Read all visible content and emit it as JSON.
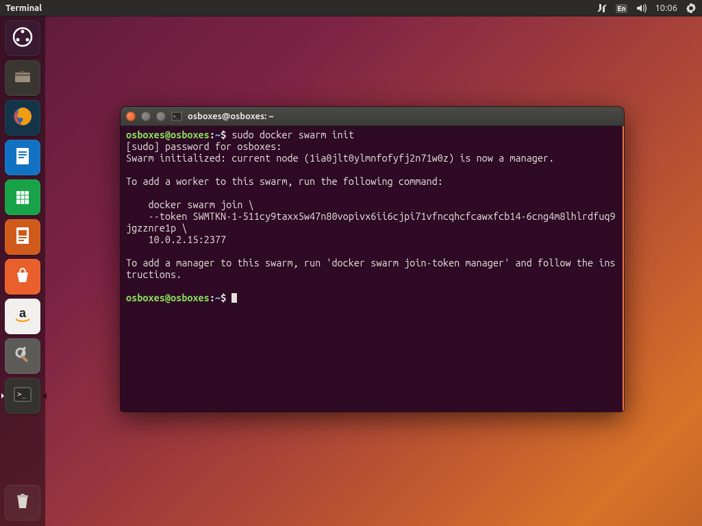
{
  "topbar": {
    "app_title": "Terminal",
    "lang_indicator": "En",
    "clock": "10:06"
  },
  "launcher": {
    "items": [
      {
        "name": "dash-icon",
        "bg": "#3a1a30"
      },
      {
        "name": "files-icon",
        "bg": "#3a3632"
      },
      {
        "name": "firefox-icon",
        "bg": "#1f597f"
      },
      {
        "name": "writer-icon",
        "bg": "#1172c4"
      },
      {
        "name": "calc-icon",
        "bg": "#19a348"
      },
      {
        "name": "impress-icon",
        "bg": "#cf5a1c"
      },
      {
        "name": "software-icon",
        "bg": "#e9602c"
      },
      {
        "name": "amazon-icon",
        "bg": "#f1f0ee"
      },
      {
        "name": "settings-icon",
        "bg": "#5d5b57"
      },
      {
        "name": "terminal-icon",
        "bg": "#34332f",
        "active": true
      }
    ]
  },
  "terminal": {
    "window_title": "osboxes@osboxes: ~",
    "prompt_user": "osboxes@osboxes",
    "prompt_path": "~",
    "prompt_sep": ":",
    "prompt_dollar": "$",
    "command1": "sudo docker swarm init",
    "lines": [
      "[sudo] password for osboxes:",
      "Swarm initialized: current node (1ia0jlt0ylmnfofyfj2n71w0z) is now a manager.",
      "",
      "To add a worker to this swarm, run the following command:",
      "",
      "    docker swarm join \\",
      "    --token SWMTKN-1-511cy9taxx5w47n80vopivx6ii6cjpi71vfncqhcfcawxfcb14-6cng4m8lhlrdfuq9jgzznre1p \\",
      "    10.0.2.15:2377",
      "",
      "To add a manager to this swarm, run 'docker swarm join-token manager' and follow the instructions.",
      ""
    ]
  }
}
